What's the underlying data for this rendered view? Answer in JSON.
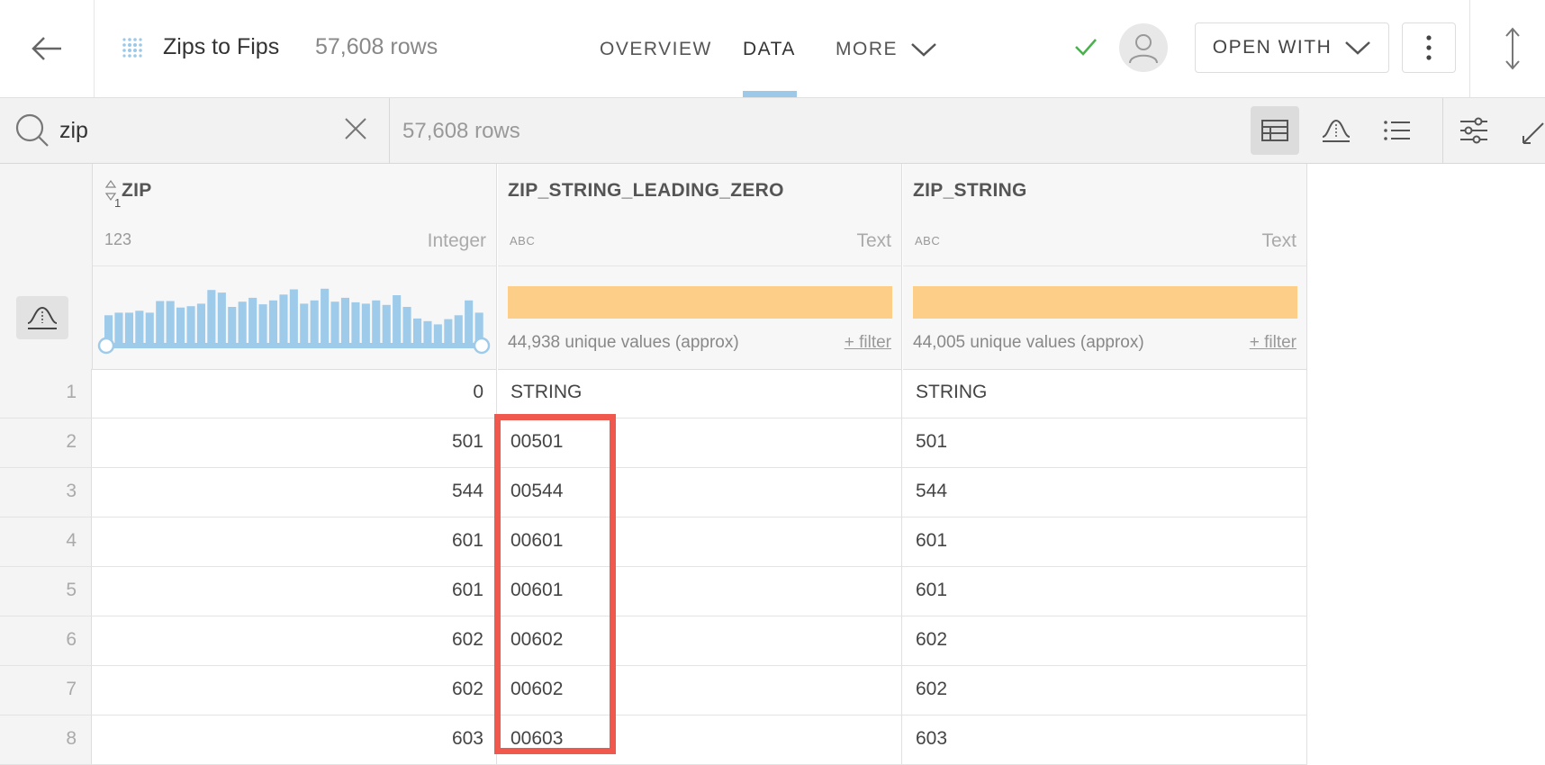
{
  "header": {
    "dataset_title": "Zips to Fips",
    "row_count": "57,608 rows",
    "tabs": [
      {
        "label": "OVERVIEW"
      },
      {
        "label": "DATA"
      },
      {
        "label": "MORE"
      }
    ],
    "active_tab": "DATA",
    "open_with_label": "OPEN WITH"
  },
  "search": {
    "value": "zip",
    "row_count": "57,608 rows"
  },
  "columns": [
    {
      "name": "ZIP",
      "type_icon": "123",
      "type_label": "Integer",
      "sort_marker": "1"
    },
    {
      "name": "ZIP_STRING_LEADING_ZERO",
      "type_icon": "ABC",
      "type_label": "Text",
      "unique": "44,938 unique values (approx)",
      "filter": "+ filter"
    },
    {
      "name": "ZIP_STRING",
      "type_icon": "ABC",
      "type_label": "Text",
      "unique": "44,005 unique values (approx)",
      "filter": "+ filter"
    }
  ],
  "rows": [
    {
      "n": "1",
      "zip": "0",
      "zip_lz": "STRING",
      "zip_str": "STRING"
    },
    {
      "n": "2",
      "zip": "501",
      "zip_lz": "00501",
      "zip_str": "501"
    },
    {
      "n": "3",
      "zip": "544",
      "zip_lz": "00544",
      "zip_str": "544"
    },
    {
      "n": "4",
      "zip": "601",
      "zip_lz": "00601",
      "zip_str": "601"
    },
    {
      "n": "5",
      "zip": "601",
      "zip_lz": "00601",
      "zip_str": "601"
    },
    {
      "n": "6",
      "zip": "602",
      "zip_lz": "00602",
      "zip_str": "602"
    },
    {
      "n": "7",
      "zip": "602",
      "zip_lz": "00602",
      "zip_str": "602"
    },
    {
      "n": "8",
      "zip": "603",
      "zip_lz": "00603",
      "zip_str": "603"
    }
  ],
  "colors": {
    "accent": "#9cc9e8",
    "histogram": "#9fcbeb",
    "text_bar": "#fcce88",
    "check": "#4caf50",
    "highlight": "#f0574d"
  },
  "zip_histogram": {
    "relative_heights": [
      0.44,
      0.48,
      0.48,
      0.51,
      0.48,
      0.66,
      0.66,
      0.56,
      0.58,
      0.62,
      0.83,
      0.79,
      0.57,
      0.65,
      0.71,
      0.61,
      0.67,
      0.76,
      0.84,
      0.62,
      0.67,
      0.85,
      0.65,
      0.71,
      0.64,
      0.62,
      0.67,
      0.6,
      0.75,
      0.57,
      0.39,
      0.35,
      0.3,
      0.38,
      0.44,
      0.67,
      0.48
    ]
  }
}
